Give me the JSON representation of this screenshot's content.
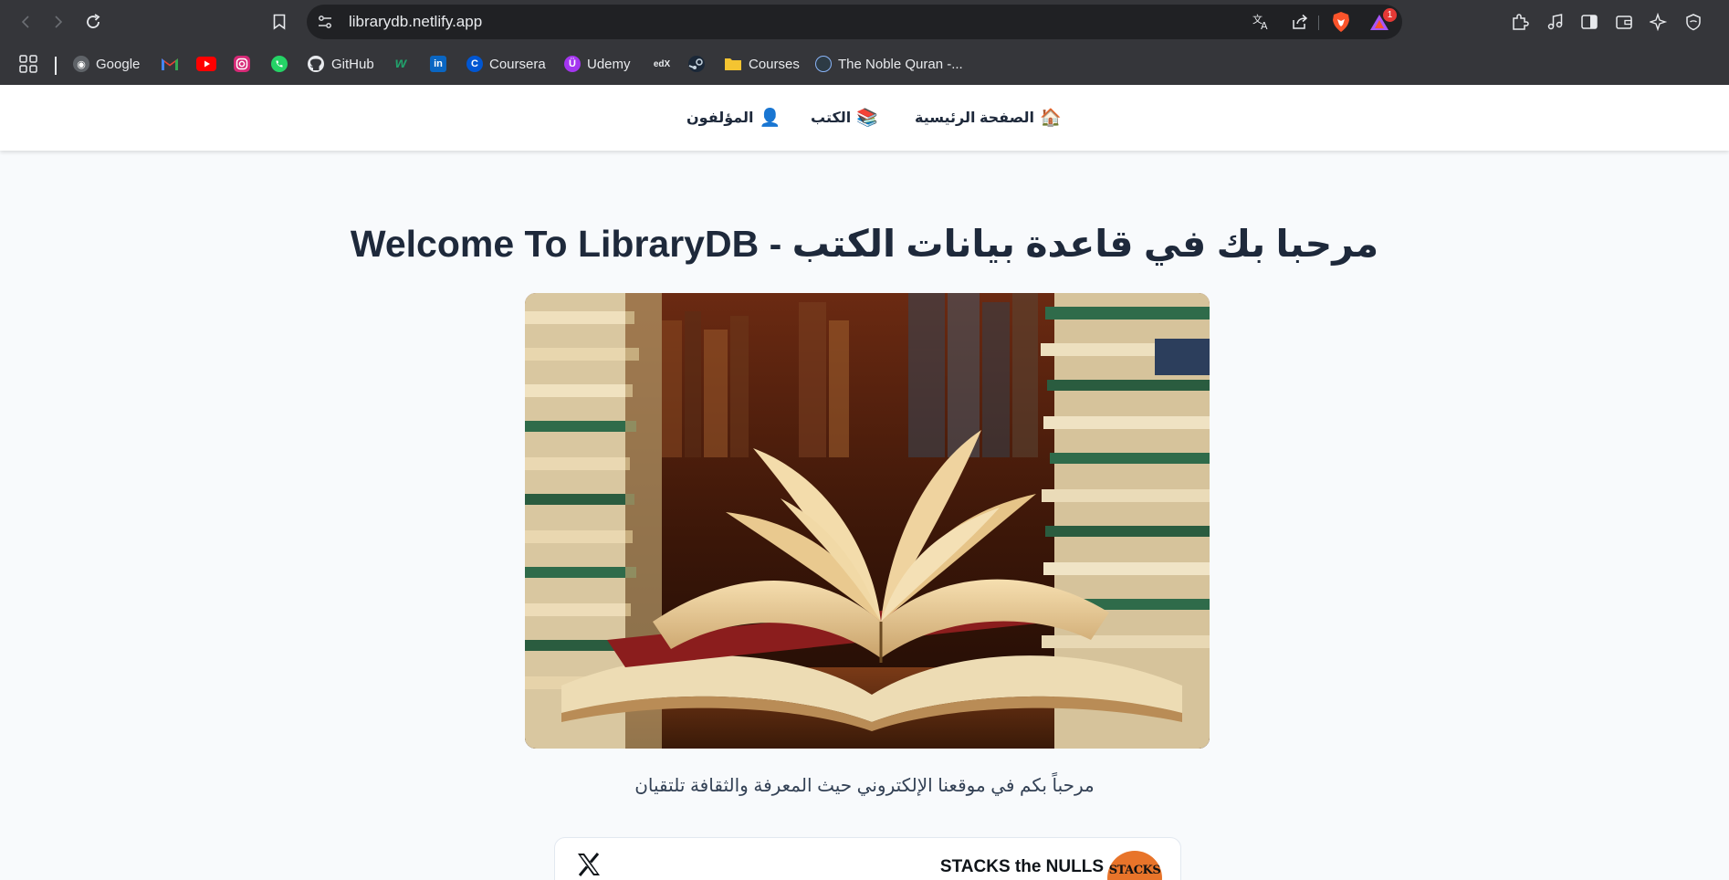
{
  "browser": {
    "url": "librarydb.netlify.app",
    "notification_count": "1",
    "bookmarks": [
      {
        "label": "Google",
        "icon": "globe-icon"
      },
      {
        "label": "",
        "icon": "gmail-icon"
      },
      {
        "label": "",
        "icon": "youtube-icon"
      },
      {
        "label": "",
        "icon": "instagram-icon"
      },
      {
        "label": "",
        "icon": "whatsapp-icon"
      },
      {
        "label": "GitHub",
        "icon": "github-icon"
      },
      {
        "label": "",
        "icon": "w-icon"
      },
      {
        "label": "",
        "icon": "linkedin-icon"
      },
      {
        "label": "Coursera",
        "icon": "coursera-icon"
      },
      {
        "label": "Udemy",
        "icon": "udemy-icon"
      },
      {
        "label": "",
        "icon": "edx-icon"
      },
      {
        "label": "",
        "icon": "steam-icon"
      },
      {
        "label": "Courses",
        "icon": "folder-icon"
      },
      {
        "label": "The Noble Quran -...",
        "icon": "quran-icon"
      }
    ],
    "fav_text": {
      "linkedin": "in",
      "edx": "edX",
      "coursera": "C",
      "udemy": "Ü",
      "w": "w"
    }
  },
  "site_nav": {
    "home": {
      "label": "الصفحة الرئيسية",
      "emoji": "🏠"
    },
    "books": {
      "label": "الكتب",
      "emoji": "📚"
    },
    "authors": {
      "label": "المؤلفون",
      "emoji": "👤"
    }
  },
  "hero": {
    "title": "Welcome To LibraryDB - مرحبا بك في قاعدة بيانات الكتب",
    "subtitle": "مرحباً بكم في موقعنا الإلكتروني حيث المعرفة والثقافة تلتقيان"
  },
  "embed": {
    "name": "STACKS the NULLS",
    "avatar_text": "STACKS"
  },
  "colors": {
    "chrome_bg": "#35363a",
    "omnibox_bg": "#202124",
    "page_bg": "#f8fafc",
    "title_color": "#1e293b",
    "brave_orange": "#fb542b"
  }
}
